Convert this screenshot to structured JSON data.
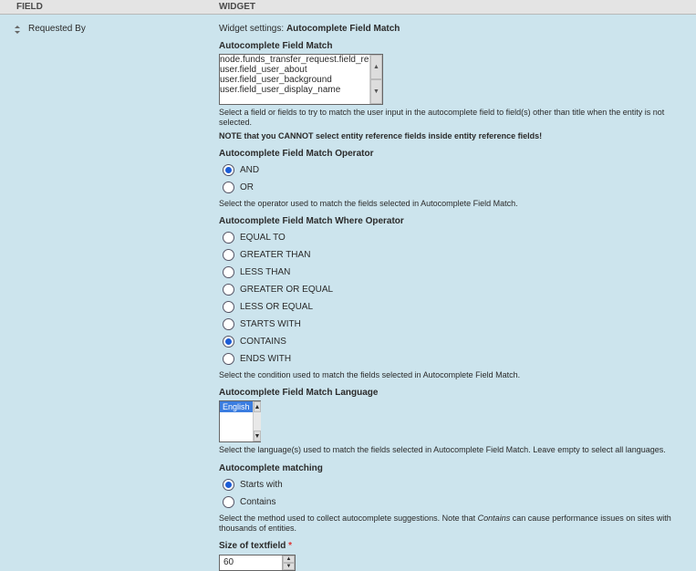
{
  "headers": {
    "field": "FIELD",
    "widget": "WIDGET"
  },
  "field_row": {
    "label": "Requested By"
  },
  "widget_settings": {
    "label": "Widget settings:",
    "value": "Autocomplete Field Match"
  },
  "sections": {
    "field_match": {
      "title": "Autocomplete Field Match",
      "options": [
        "node.funds_transfer_request.field_requested_by",
        "user.field_user_about",
        "user.field_user_background",
        "user.field_user_display_name"
      ],
      "selected_first": "node.funds_transfer_request.field_requested_by",
      "selected_last": "user.field_user_display_name",
      "help1": "Select a field or fields to try to match the user input in the autocomplete field to field(s) other than title when the entity is not selected.",
      "help2_prefix": "NOTE that you CANNOT select entity reference fields inside entity reference fields!"
    },
    "operator": {
      "title": "Autocomplete Field Match Operator",
      "options": [
        "AND",
        "OR"
      ],
      "selected": "AND",
      "help": "Select the operator used to match the fields selected in Autocomplete Field Match."
    },
    "where_operator": {
      "title": "Autocomplete Field Match Where Operator",
      "options": [
        "EQUAL TO",
        "GREATER THAN",
        "LESS THAN",
        "GREATER OR EQUAL",
        "LESS OR EQUAL",
        "STARTS WITH",
        "CONTAINS",
        "ENDS WITH"
      ],
      "selected": "CONTAINS",
      "help": "Select the condition used to match the fields selected in Autocomplete Field Match."
    },
    "language": {
      "title": "Autocomplete Field Match Language",
      "options": [
        "English"
      ],
      "selected": "English",
      "help": "Select the language(s) used to match the fields selected in Autocomplete Field Match. Leave empty to select all languages."
    },
    "matching": {
      "title": "Autocomplete matching",
      "options": [
        "Starts with",
        "Contains"
      ],
      "selected": "Starts with",
      "help_pre": "Select the method used to collect autocomplete suggestions. Note that ",
      "help_em": "Contains",
      "help_post": " can cause performance issues on sites with thousands of entities."
    },
    "size": {
      "title": "Size of textfield",
      "required": "*",
      "value": "60"
    }
  }
}
